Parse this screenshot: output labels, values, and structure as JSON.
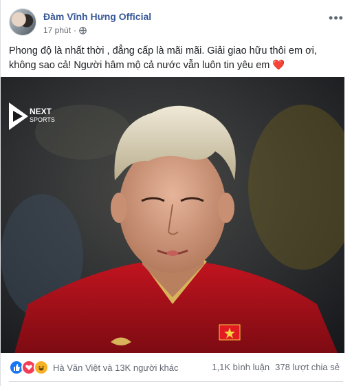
{
  "post": {
    "author": "Đàm Vĩnh Hưng Official",
    "time": "17 phút",
    "privacy_icon": "globe-icon",
    "more_icon": "more-options-icon",
    "text_line1": "Phong độ là nhất thời , đẳng cấp là mãi mãi. Giải giao hữu thôi em ơi,",
    "text_line2": "không sao cả! Người hâm mộ cả nước vẫn luôn tin yêu em",
    "text_emoji": "❤️"
  },
  "media": {
    "watermark_line1": "NEXT",
    "watermark_line2": "SPORTS",
    "jersey_color": "#b3121f",
    "hair_color": "#d8d2bf"
  },
  "footer": {
    "reaction_icons": [
      "like-icon",
      "love-icon",
      "haha-icon"
    ],
    "reactions_label": "Hà Văn Việt và 13K người khác",
    "comments": "1,1K bình luận",
    "shares": "378 lượt chia sẻ"
  }
}
